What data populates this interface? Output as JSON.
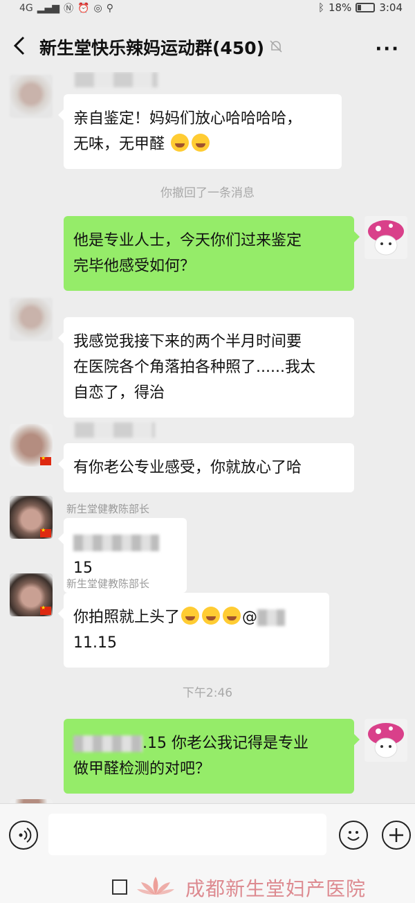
{
  "status": {
    "battery_pct": "18%",
    "time": "3:04",
    "carrier_icons": "4G"
  },
  "header": {
    "title": "新生堂快乐辣妈运动群(450)",
    "more_label": "···"
  },
  "messages": {
    "m1": {
      "text_l1": "亲自鉴定！妈妈们放心哈哈哈哈，",
      "text_l2": "无味，无甲醛"
    },
    "recall": "你撤回了一条消息",
    "m2": {
      "text_l1": "他是专业人士，今天你们过来鉴定",
      "text_l2": "完毕他感受如何？"
    },
    "m3": {
      "text_l1": "我感觉我接下来的两个半月时间要",
      "text_l2": "在医院各个角落拍各种照了......我太",
      "text_l3": "自恋了，得治"
    },
    "m4": {
      "text": "有你老公专业感受，你就放心了哈"
    },
    "m5": {
      "sender": "新生堂健教陈部长",
      "text_suffix": "15"
    },
    "m6": {
      "sender": "新生堂健教陈部长",
      "text_l1": "你拍照就上头了",
      "mention": "@",
      "text_l2": "11.15"
    },
    "time_stamp": "下午2:46",
    "m7": {
      "text_l1_suffix": ".15 你老公我记得是专业",
      "text_l2": "做甲醛检测的对吧？"
    }
  },
  "input": {
    "placeholder": ""
  },
  "watermark": {
    "text": "成都新生堂妇产医院"
  }
}
